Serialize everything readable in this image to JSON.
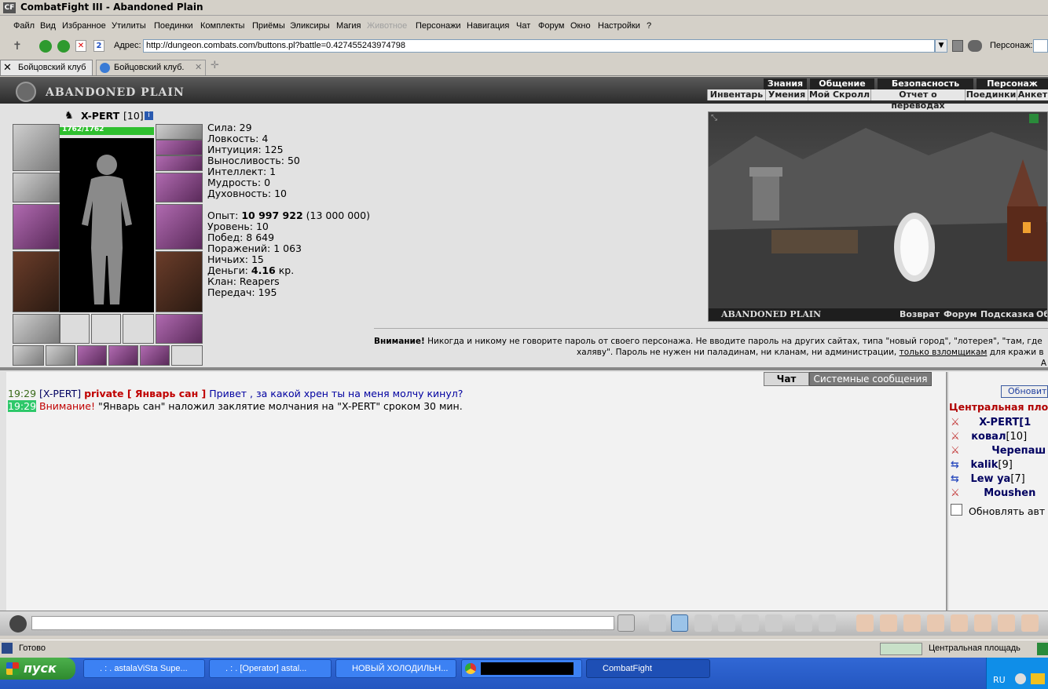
{
  "window": {
    "title": "CombatFight III - Abandoned Plain",
    "logo": "CF"
  },
  "menu": [
    "Файл",
    "Вид",
    "Избранное",
    "Утилиты",
    "Поединки",
    "Комплекты",
    "Приёмы",
    "Эликсиры",
    "Магия",
    "Животное",
    "Персонажи",
    "Навигация",
    "Чат",
    "Форум",
    "Окно",
    "Настройки",
    "?"
  ],
  "address": {
    "label": "Адрес:",
    "url": "http://dungeon.combats.com/buttons.pl?battle=0.427455243974798",
    "character_label": "Персонаж:"
  },
  "tabs": [
    {
      "label": "Бойцовский клуб"
    },
    {
      "label": "Бойцовский клуб."
    }
  ],
  "game": {
    "location_title": "ABANDONED PLAIN",
    "nav_top": [
      "Знания",
      "Общение",
      "Безопасность",
      "Персонаж"
    ],
    "nav_bottom": [
      "Инвентарь",
      "Умения",
      "Мой Скролл",
      "Отчет о переводах",
      "Поединки",
      "Анкет"
    ],
    "character": {
      "name": "X-PERT",
      "level": "[10]",
      "hp": "1762/1762",
      "hp_fraction": 1.0
    },
    "stats": {
      "strength": "Сила: 29",
      "agility": "Ловкость: 4",
      "intuition": "Интуиция: 125",
      "endurance": "Выносливость: 50",
      "intellect": "Интеллект: 1",
      "wisdom": "Мудрость: 0",
      "spirit": "Духовность: 10",
      "exp_label": "Опыт:",
      "exp_value": "10 997 922",
      "exp_next": "(13 000 000)",
      "level": "Уровень: 10",
      "wins": "Побед: 8 649",
      "losses": "Поражений: 1 063",
      "draws": "Ничьих: 15",
      "money_label": "Деньги:",
      "money_value": "4.16",
      "money_unit": "кр.",
      "clan": "Клан: Reapers",
      "transfers": "Передач: 195"
    },
    "scene_footer": {
      "title": "ABANDONED PLAIN",
      "links": [
        "Возврат",
        "Форум",
        "Подсказка",
        "Об"
      ]
    },
    "warning": {
      "bold": "Внимание!",
      "line1": "Никогда и никому не говорите пароль от своего персонажа. Не вводите пароль на других сайтах, типа \"новый город\", \"лотерея\", \"там, где",
      "line2a": "халяву\". Пароль не нужен ни паладинам, ни кланам, ни администрации,",
      "line2link": "только взломщикам",
      "line2b": "для кражи в",
      "line3": "А"
    }
  },
  "chat": {
    "tabs": [
      "Чат",
      "Системные сообщения"
    ],
    "messages": [
      {
        "time": "19:29",
        "from": "[X-PERT]",
        "private": "private [ Январь сан ]",
        "text": "Привет , за какой хрен ты на меня молчу кинул?"
      },
      {
        "time": "19:29",
        "alert": "Внимание!",
        "text": "\"Январь сан\" наложил заклятие молчания на \"X-PERT\" сроком 30 мин."
      }
    ]
  },
  "online": {
    "refresh": "Обновить",
    "location": "Центральная пло",
    "users": [
      {
        "name": "X-PERT[1"
      },
      {
        "name": "ковал",
        "level": "[10]"
      },
      {
        "name": "Черепаш"
      },
      {
        "name": "kalik",
        "level": "[9]"
      },
      {
        "name": "Lew ya",
        "level": "[7]"
      },
      {
        "name": "Moushen"
      }
    ],
    "autorefresh": "Обновлять авт"
  },
  "status": {
    "text": "Готово",
    "location": "Центральная площадь"
  },
  "taskbar": {
    "start": "пуск",
    "tasks": [
      ". : . astalaViSta Supe...",
      ". : . [Operator] astal...",
      "НОВЫЙ ХОЛОДИЛЬН...",
      "",
      "CombatFight"
    ],
    "lang": "RU"
  }
}
